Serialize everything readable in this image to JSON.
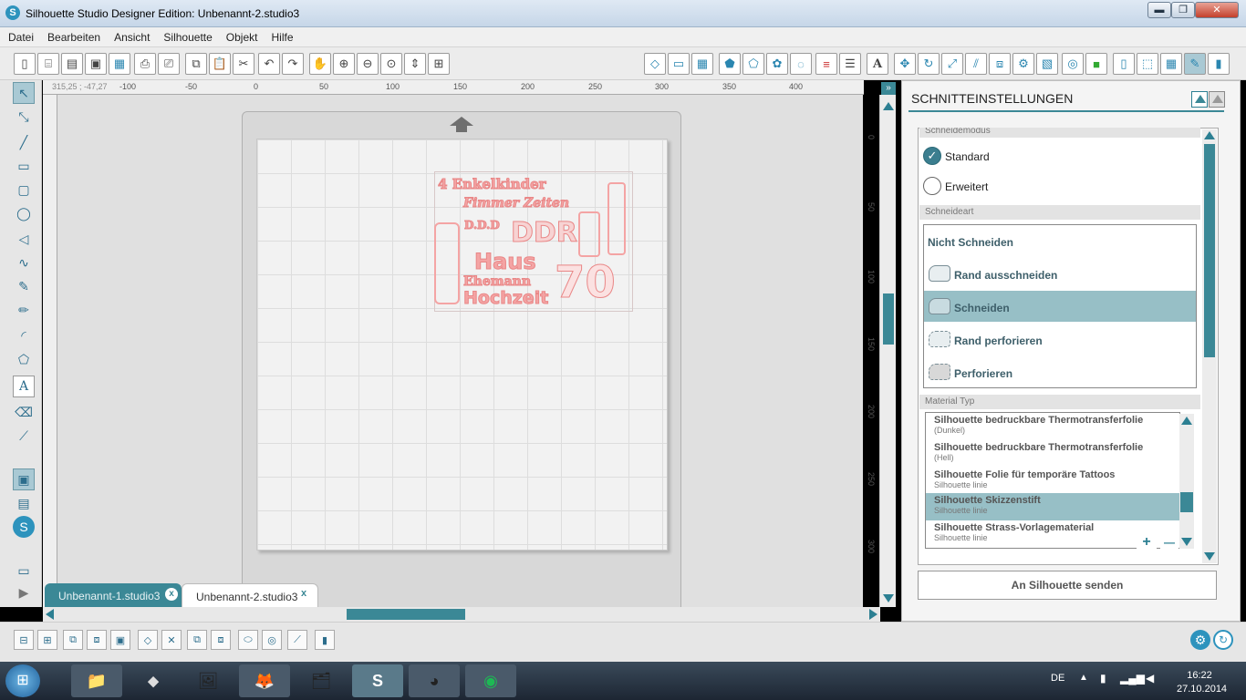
{
  "window": {
    "title": "Silhouette Studio Designer Edition: Unbenannt-2.studio3",
    "logo": "S",
    "min": "▬",
    "max": "❐",
    "close": "✕"
  },
  "menu": [
    "Datei",
    "Bearbeiten",
    "Ansicht",
    "Silhouette",
    "Objekt",
    "Hilfe"
  ],
  "ruler": {
    "coords": "315,25 ; -47,27",
    "top_ticks": [
      "-100",
      "-50",
      "0",
      "50",
      "100",
      "150",
      "200",
      "250",
      "300",
      "350",
      "400"
    ],
    "left_ticks": [
      "0",
      "50",
      "100",
      "150",
      "200",
      "250",
      "300"
    ]
  },
  "design": {
    "lines": [
      "4 Enkelkinder",
      "Fimmer Zeiten",
      "D.D.D",
      "DDR",
      "Haus",
      "Ehemann",
      "Hochzeit",
      "70"
    ]
  },
  "tabs": [
    {
      "label": "Unbenannt-1.studio3",
      "close": "x"
    },
    {
      "label": "Unbenannt-2.studio3",
      "close": "x"
    }
  ],
  "panel": {
    "title": "SCHNITTEINSTELLUNGEN",
    "schneidemodus": "Schneidemodus",
    "modes": [
      {
        "label": "Standard",
        "selected": true
      },
      {
        "label": "Erweitert",
        "selected": false
      }
    ],
    "schneideart": "Schneideart",
    "cut_none": "Nicht Schneiden",
    "cut_options": [
      {
        "label": "Rand ausschneiden"
      },
      {
        "label": "Schneiden",
        "selected": true
      },
      {
        "label": "Rand perforieren"
      },
      {
        "label": "Perforieren"
      }
    ],
    "material_hdr": "Material Typ",
    "materials": [
      {
        "name": "Silhouette bedruckbare Thermotransferfolie",
        "sub": "(Dunkel)"
      },
      {
        "name": "Silhouette bedruckbare Thermotransferfolie",
        "sub": "(Hell)"
      },
      {
        "name": "Silhouette Folie für temporäre Tattoos",
        "sub": "Silhouette linie"
      },
      {
        "name": "Silhouette Skizzenstift",
        "sub": "Silhouette linie",
        "selected": true
      },
      {
        "name": "Silhouette Strass-Vorlagematerial",
        "sub": "Silhouette linie"
      }
    ],
    "add": "+",
    "remove": "—",
    "send": "An Silhouette senden"
  },
  "taskbar": {
    "lang": "DE",
    "time": "16:22",
    "date": "27.10.2014"
  },
  "colors": {
    "accent": "#3b8896",
    "design": "#f4a4a4",
    "selected": "#97bfc6"
  }
}
